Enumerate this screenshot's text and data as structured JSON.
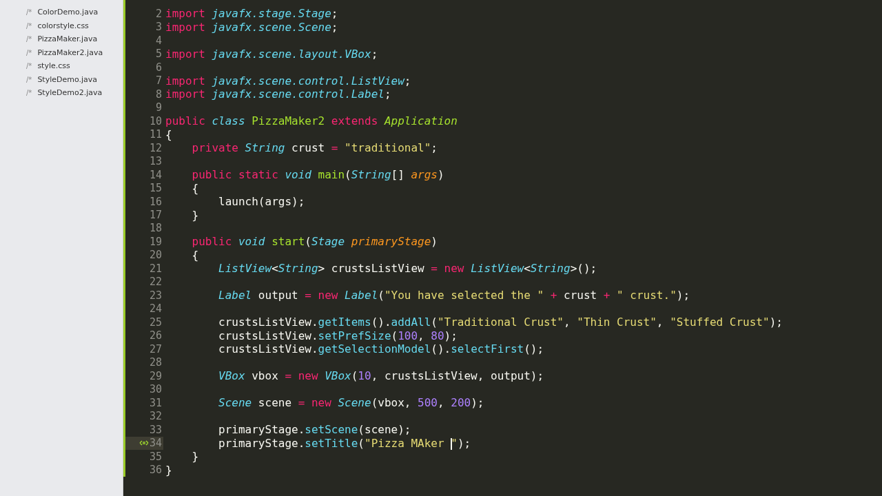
{
  "sidebar": {
    "files": [
      {
        "prefix": "/*",
        "name": "ColorDemo.java"
      },
      {
        "prefix": "/*",
        "name": "colorstyle.css"
      },
      {
        "prefix": "/*",
        "name": "PizzaMaker.java"
      },
      {
        "prefix": "/*",
        "name": "PizzaMaker2.java"
      },
      {
        "prefix": "/*",
        "name": "style.css"
      },
      {
        "prefix": "/*",
        "name": "StyleDemo.java"
      },
      {
        "prefix": "/*",
        "name": "StyleDemo2.java"
      }
    ]
  },
  "editor": {
    "lines": [
      {
        "number": "2",
        "current": false,
        "tokens": [
          {
            "kind": "kw",
            "text": "import "
          },
          {
            "kind": "type",
            "text": "javafx.stage.Stage"
          },
          {
            "kind": "plain",
            "text": ";"
          }
        ]
      },
      {
        "number": "3",
        "current": false,
        "tokens": [
          {
            "kind": "kw",
            "text": "import "
          },
          {
            "kind": "type",
            "text": "javafx.scene.Scene"
          },
          {
            "kind": "plain",
            "text": ";"
          }
        ]
      },
      {
        "number": "4",
        "current": false
      },
      {
        "number": "5",
        "current": false,
        "tokens": [
          {
            "kind": "kw",
            "text": "import "
          },
          {
            "kind": "type",
            "text": "javafx.scene.layout.VBox"
          },
          {
            "kind": "plain",
            "text": ";"
          }
        ]
      },
      {
        "number": "6",
        "current": false
      },
      {
        "number": "7",
        "current": false,
        "tokens": [
          {
            "kind": "kw",
            "text": "import "
          },
          {
            "kind": "type",
            "text": "javafx.scene.control.ListView"
          },
          {
            "kind": "plain",
            "text": ";"
          }
        ]
      },
      {
        "number": "8",
        "current": false,
        "tokens": [
          {
            "kind": "kw",
            "text": "import "
          },
          {
            "kind": "type",
            "text": "javafx.scene.control.Label"
          },
          {
            "kind": "plain",
            "text": ";"
          }
        ]
      },
      {
        "number": "9",
        "current": false
      },
      {
        "number": "10",
        "current": false,
        "tokens": [
          {
            "kind": "kw",
            "text": "public "
          },
          {
            "kind": "type",
            "text": "class "
          },
          {
            "kind": "name",
            "text": "PizzaMaker2 "
          },
          {
            "kind": "kw",
            "text": "extends "
          },
          {
            "kind": "parent",
            "text": "Application"
          }
        ]
      },
      {
        "number": "11",
        "current": false,
        "tokens": [
          {
            "kind": "plain",
            "text": "{"
          }
        ]
      },
      {
        "number": "12",
        "current": false,
        "tokens": [
          {
            "kind": "kw",
            "text": "    private "
          },
          {
            "kind": "type",
            "text": "String"
          },
          {
            "kind": "plain",
            "text": " crust "
          },
          {
            "kind": "kw",
            "text": "= "
          },
          {
            "kind": "str",
            "text": "\"traditional\""
          },
          {
            "kind": "plain",
            "text": ";"
          }
        ]
      },
      {
        "number": "13",
        "current": false
      },
      {
        "number": "14",
        "current": false,
        "tokens": [
          {
            "kind": "kw",
            "text": "    public static "
          },
          {
            "kind": "type",
            "text": "void "
          },
          {
            "kind": "name",
            "text": "main"
          },
          {
            "kind": "plain",
            "text": "("
          },
          {
            "kind": "type",
            "text": "String"
          },
          {
            "kind": "plain",
            "text": "[] "
          },
          {
            "kind": "param",
            "text": "args"
          },
          {
            "kind": "plain",
            "text": ")"
          }
        ]
      },
      {
        "number": "15",
        "current": false,
        "tokens": [
          {
            "kind": "plain",
            "text": "    {"
          }
        ]
      },
      {
        "number": "16",
        "current": false,
        "tokens": [
          {
            "kind": "plain",
            "text": "        launch(args);"
          }
        ]
      },
      {
        "number": "17",
        "current": false,
        "tokens": [
          {
            "kind": "plain",
            "text": "    }"
          }
        ]
      },
      {
        "number": "18",
        "current": false
      },
      {
        "number": "19",
        "current": false,
        "tokens": [
          {
            "kind": "kw",
            "text": "    public "
          },
          {
            "kind": "type",
            "text": "void "
          },
          {
            "kind": "name",
            "text": "start"
          },
          {
            "kind": "plain",
            "text": "("
          },
          {
            "kind": "type",
            "text": "Stage "
          },
          {
            "kind": "param",
            "text": "primaryStage"
          },
          {
            "kind": "plain",
            "text": ")"
          }
        ]
      },
      {
        "number": "20",
        "current": false,
        "tokens": [
          {
            "kind": "plain",
            "text": "    {"
          }
        ]
      },
      {
        "number": "21",
        "current": false,
        "tokens": [
          {
            "kind": "type",
            "text": "        ListView"
          },
          {
            "kind": "plain",
            "text": "<"
          },
          {
            "kind": "type",
            "text": "String"
          },
          {
            "kind": "plain",
            "text": "> crustsListView "
          },
          {
            "kind": "kw",
            "text": "= new "
          },
          {
            "kind": "type",
            "text": "ListView"
          },
          {
            "kind": "plain",
            "text": "<"
          },
          {
            "kind": "type",
            "text": "String"
          },
          {
            "kind": "plain",
            "text": ">();"
          }
        ]
      },
      {
        "number": "22",
        "current": false
      },
      {
        "number": "23",
        "current": false,
        "tokens": [
          {
            "kind": "type",
            "text": "        Label"
          },
          {
            "kind": "plain",
            "text": " output "
          },
          {
            "kind": "kw",
            "text": "= new "
          },
          {
            "kind": "type",
            "text": "Label"
          },
          {
            "kind": "plain",
            "text": "("
          },
          {
            "kind": "str",
            "text": "\"You have selected the \""
          },
          {
            "kind": "kw",
            "text": " + "
          },
          {
            "kind": "plain",
            "text": "crust "
          },
          {
            "kind": "kw",
            "text": "+ "
          },
          {
            "kind": "str",
            "text": "\" crust.\""
          },
          {
            "kind": "plain",
            "text": ");"
          }
        ]
      },
      {
        "number": "24",
        "current": false
      },
      {
        "number": "25",
        "current": false,
        "tokens": [
          {
            "kind": "plain",
            "text": "        crustsListView."
          },
          {
            "kind": "call",
            "text": "getItems"
          },
          {
            "kind": "plain",
            "text": "()."
          },
          {
            "kind": "call",
            "text": "addAll"
          },
          {
            "kind": "plain",
            "text": "("
          },
          {
            "kind": "str",
            "text": "\"Traditional Crust\""
          },
          {
            "kind": "plain",
            "text": ", "
          },
          {
            "kind": "str",
            "text": "\"Thin Crust\""
          },
          {
            "kind": "plain",
            "text": ", "
          },
          {
            "kind": "str",
            "text": "\"Stuffed Crust\""
          },
          {
            "kind": "plain",
            "text": ");"
          }
        ]
      },
      {
        "number": "26",
        "current": false,
        "tokens": [
          {
            "kind": "plain",
            "text": "        crustsListView."
          },
          {
            "kind": "call",
            "text": "setPrefSize"
          },
          {
            "kind": "plain",
            "text": "("
          },
          {
            "kind": "num",
            "text": "100"
          },
          {
            "kind": "plain",
            "text": ", "
          },
          {
            "kind": "num",
            "text": "80"
          },
          {
            "kind": "plain",
            "text": ");"
          }
        ]
      },
      {
        "number": "27",
        "current": false,
        "tokens": [
          {
            "kind": "plain",
            "text": "        crustsListView."
          },
          {
            "kind": "call",
            "text": "getSelectionModel"
          },
          {
            "kind": "plain",
            "text": "()."
          },
          {
            "kind": "call",
            "text": "selectFirst"
          },
          {
            "kind": "plain",
            "text": "();"
          }
        ]
      },
      {
        "number": "28",
        "current": false
      },
      {
        "number": "29",
        "current": false,
        "tokens": [
          {
            "kind": "type",
            "text": "        VBox"
          },
          {
            "kind": "plain",
            "text": " vbox "
          },
          {
            "kind": "kw",
            "text": "= new "
          },
          {
            "kind": "type",
            "text": "VBox"
          },
          {
            "kind": "plain",
            "text": "("
          },
          {
            "kind": "num",
            "text": "10"
          },
          {
            "kind": "plain",
            "text": ", crustsListView, output);"
          }
        ]
      },
      {
        "number": "30",
        "current": false
      },
      {
        "number": "31",
        "current": false,
        "tokens": [
          {
            "kind": "type",
            "text": "        Scene"
          },
          {
            "kind": "plain",
            "text": " scene "
          },
          {
            "kind": "kw",
            "text": "= new "
          },
          {
            "kind": "type",
            "text": "Scene"
          },
          {
            "kind": "plain",
            "text": "(vbox, "
          },
          {
            "kind": "num",
            "text": "500"
          },
          {
            "kind": "plain",
            "text": ", "
          },
          {
            "kind": "num",
            "text": "200"
          },
          {
            "kind": "plain",
            "text": ");"
          }
        ]
      },
      {
        "number": "32",
        "current": false
      },
      {
        "number": "33",
        "current": false,
        "tokens": [
          {
            "kind": "plain",
            "text": "        primaryStage."
          },
          {
            "kind": "call",
            "text": "setScene"
          },
          {
            "kind": "plain",
            "text": "(scene);"
          }
        ]
      },
      {
        "number": "34",
        "current": true,
        "tokens": [
          {
            "kind": "plain",
            "text": "        primaryStage."
          },
          {
            "kind": "call",
            "text": "setTitle"
          },
          {
            "kind": "plain",
            "text": "("
          },
          {
            "kind": "str",
            "text": "\"Pizza MAker "
          },
          {
            "kind": "caret"
          },
          {
            "kind": "str",
            "text": "\""
          },
          {
            "kind": "plain",
            "text": ");"
          }
        ]
      },
      {
        "number": "35",
        "current": false,
        "tokens": [
          {
            "kind": "plain",
            "text": "    }"
          }
        ]
      },
      {
        "number": "36",
        "current": false,
        "tokens": [
          {
            "kind": "plain",
            "text": "}"
          }
        ]
      }
    ]
  }
}
